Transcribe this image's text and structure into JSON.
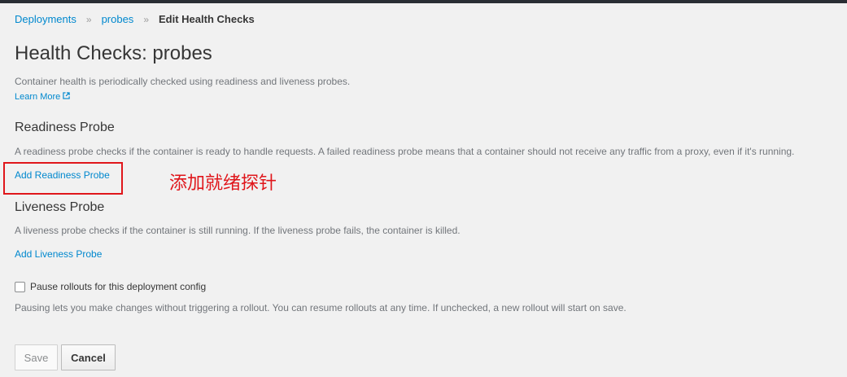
{
  "breadcrumb": {
    "items": [
      "Deployments",
      "probes"
    ],
    "current": "Edit Health Checks",
    "separator": "»"
  },
  "page": {
    "title": "Health Checks: probes",
    "description": "Container health is periodically checked using readiness and liveness probes.",
    "learn_more": "Learn More"
  },
  "readiness": {
    "title": "Readiness Probe",
    "description": "A readiness probe checks if the container is ready to handle requests. A failed readiness probe means that a container should not receive any traffic from a proxy, even if it's running.",
    "add_label": "Add Readiness Probe"
  },
  "annotation": {
    "text": "添加就绪探针",
    "color": "#e0161b"
  },
  "liveness": {
    "title": "Liveness Probe",
    "description": "A liveness probe checks if the container is still running. If the liveness probe fails, the container is killed.",
    "add_label": "Add Liveness Probe"
  },
  "pause": {
    "label": "Pause rollouts for this deployment config",
    "checked": false,
    "help": "Pausing lets you make changes without triggering a rollout. You can resume rollouts at any time. If unchecked, a new rollout will start on save."
  },
  "buttons": {
    "save": "Save",
    "cancel": "Cancel"
  },
  "colors": {
    "link": "#0088ce",
    "background": "#f1f1f1",
    "text": "#363636",
    "muted": "#72767b"
  }
}
